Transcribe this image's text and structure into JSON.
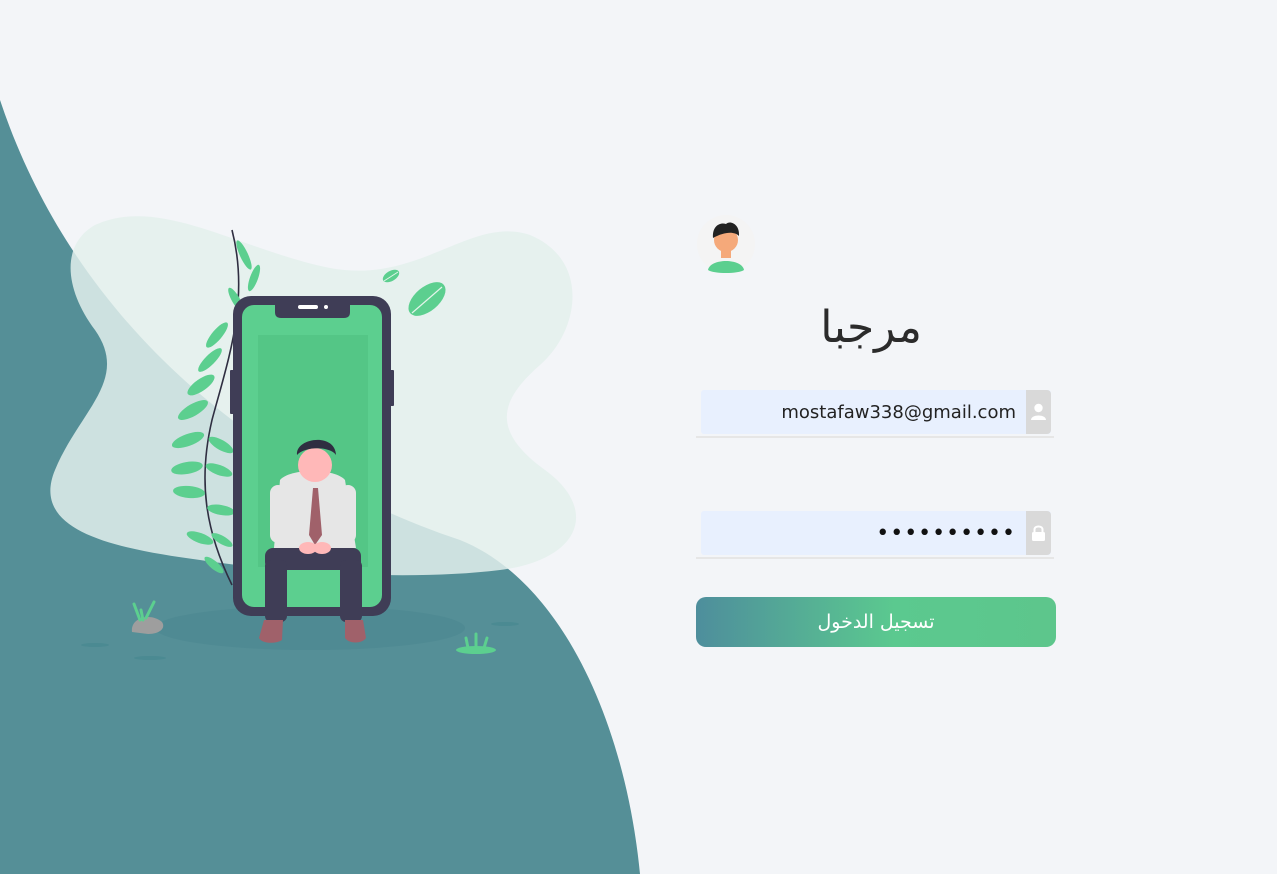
{
  "colors": {
    "background": "#f3f5f8",
    "wave": "#558f97",
    "accent_green": "#5ccf8f",
    "button_gradient_start": "#4e8e9c",
    "button_gradient_end": "#5dc68c",
    "input_background": "#e8f0fe"
  },
  "illustration": {
    "icon": "person-sitting-with-phone-illustration"
  },
  "login": {
    "avatar_icon": "user-avatar-icon",
    "welcome": "مرجبا",
    "email": {
      "value": "mostafaw338@gmail.com",
      "icon": "user-icon"
    },
    "password": {
      "value": "••••••••••",
      "icon": "lock-icon"
    },
    "submit_label": "تسجيل الدخول"
  }
}
